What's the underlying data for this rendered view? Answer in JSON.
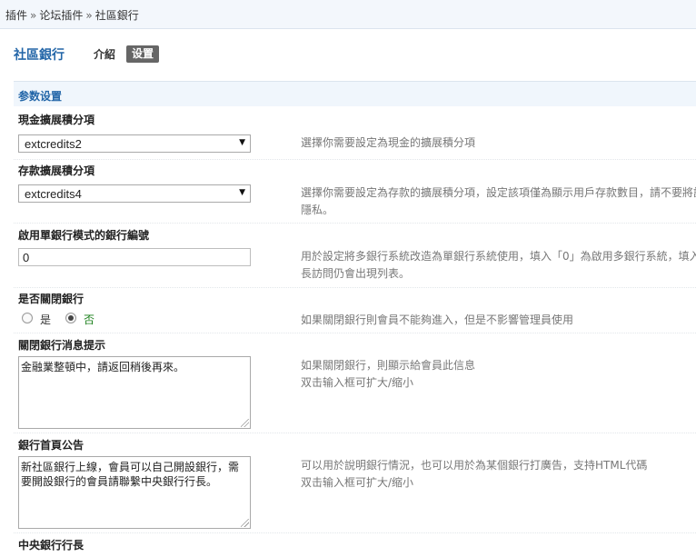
{
  "breadcrumb": {
    "items": [
      "插件",
      "论坛插件",
      "社區銀行"
    ],
    "separator": "»"
  },
  "plugin": {
    "title": "社區銀行",
    "tabs": [
      {
        "label": "介紹",
        "active": false
      },
      {
        "label": "设置",
        "active": true
      }
    ]
  },
  "section": {
    "title": "参数设置"
  },
  "settings": {
    "cash_credit": {
      "label": "現金擴展積分項",
      "value": "extcredits2",
      "tip": "選擇你需要設定為現金的擴展積分項"
    },
    "deposit_credit": {
      "label": "存款擴展積分項",
      "value": "extcredits4",
      "tip_line1": "選擇你需要設定為存款的擴展積分項，設定該項僅為顯示用戶存款數目，請不要將該",
      "tip_line2": "隱私。"
    },
    "single_bank": {
      "label": "啟用單銀行模式的銀行編號",
      "value": "0",
      "tip_line1": "用於設定將多銀行系統改造為單銀行系統使用，填入「0」為啟用多銀行系統，填入",
      "tip_line2": "長訪問仍會出現列表。"
    },
    "close_bank": {
      "label": "是否關閉銀行",
      "option_yes": "是",
      "option_no": "否",
      "selected": "否",
      "tip": "如果關閉銀行則會員不能夠進入，但是不影響管理員使用"
    },
    "close_message": {
      "label": "關閉銀行消息提示",
      "value": "金融業整頓中，請返回稍後再來。",
      "tip_line1": "如果關閉銀行，則顯示給會員此信息",
      "tip_line2": "双击输入框可扩大/缩小"
    },
    "homepage_notice": {
      "label": "銀行首頁公告",
      "value": "新社區銀行上線，會員可以自己開設銀行，需要開設銀行的會員請聯繫中央銀行行長。",
      "tip_line1": "可以用於說明銀行情況，也可以用於為某個銀行打廣告，支持HTML代碼",
      "tip_line2": "双击输入框可扩大/缩小"
    },
    "central_governor": {
      "label": "中央銀行行長"
    }
  },
  "colors": {
    "accent": "#2366a8",
    "active_tab_bg": "#666666",
    "tip_text": "#777777",
    "selected_radio_text": "#1a7f1a"
  }
}
